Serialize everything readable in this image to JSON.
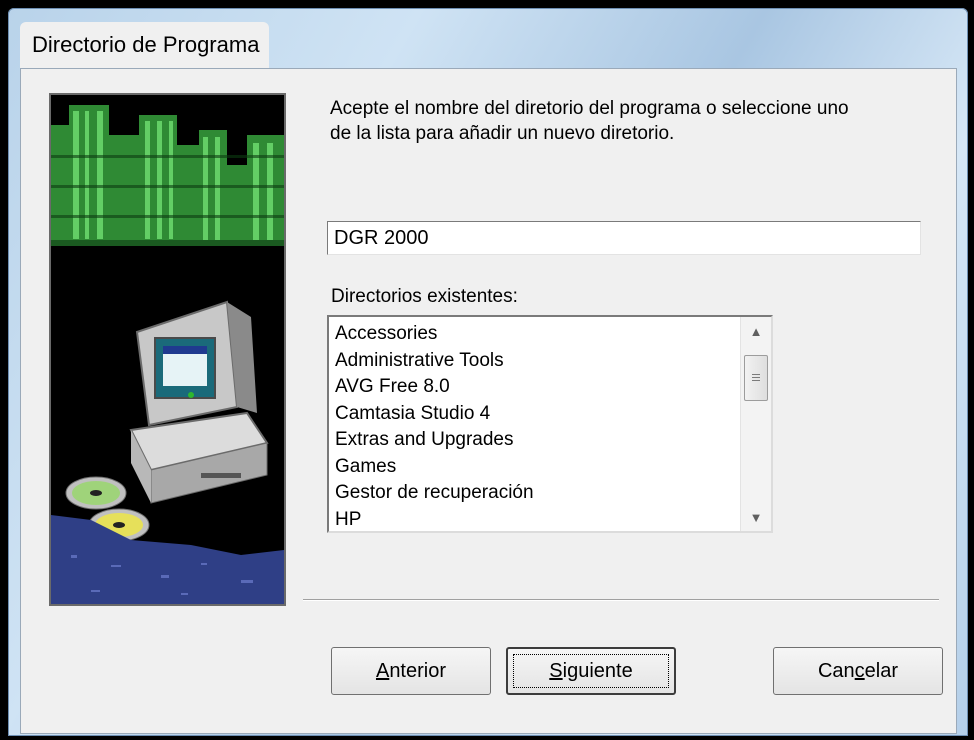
{
  "window": {
    "title": "Directorio de Programa"
  },
  "prompt": {
    "line1": "Acepte el nombre del diretorio del programa o seleccione uno",
    "line2": "de la lista para añadir un nuevo diretorio."
  },
  "directory_input": {
    "value": "DGR 2000"
  },
  "list": {
    "label": "Directorios existentes:",
    "items": [
      "Accessories",
      "Administrative Tools",
      "AVG Free 8.0",
      "Camtasia Studio 4",
      "Extras and Upgrades",
      "Games",
      "Gestor de recuperación",
      "HP"
    ]
  },
  "buttons": {
    "back": {
      "pre": "",
      "accel": "A",
      "post": "nterior"
    },
    "next": {
      "pre": "",
      "accel": "S",
      "post": "iguiente"
    },
    "cancel": {
      "pre": "Can",
      "accel": "c",
      "post": "elar"
    }
  },
  "icons": {
    "scroll_up": "scroll-up-arrow-icon",
    "scroll_down": "scroll-down-arrow-icon",
    "art": "setup-computer-city-art"
  }
}
